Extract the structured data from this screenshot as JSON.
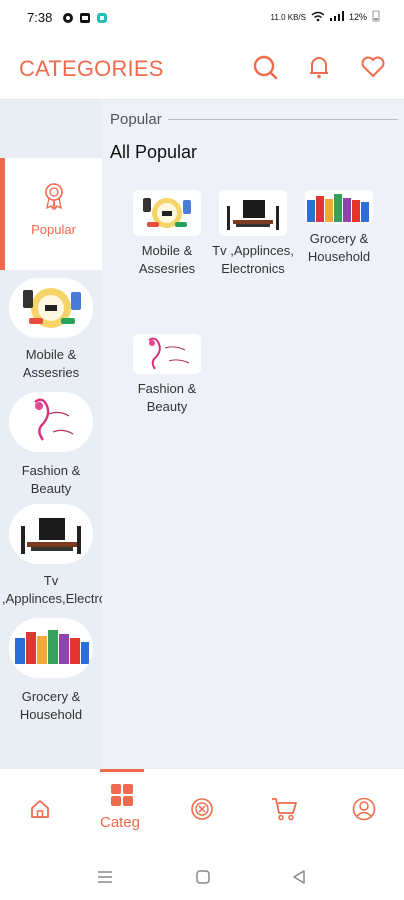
{
  "status": {
    "time": "7:38",
    "network": "11.0 KB/S",
    "battery": "12%",
    "icons": [
      "notification-icon",
      "gallery-icon",
      "app-badge-icon",
      "wifi-icon",
      "signal-icon",
      "battery-icon"
    ]
  },
  "app": {
    "title": "CATEGORIES",
    "actions": [
      "search-icon",
      "bell-icon",
      "heart-icon"
    ],
    "accent": "#ee6c4d"
  },
  "sidebar": {
    "items": [
      {
        "label": "Popular",
        "icon": "ribbon-icon",
        "active": true
      },
      {
        "label": "Mobile & Assesries",
        "image": "mobile-accessories-image"
      },
      {
        "label": "Fashion & Beauty",
        "image": "fashion-beauty-image"
      },
      {
        "label": "Tv ,Applinces,Electronics",
        "image": "tv-appliances-image"
      },
      {
        "label": "Grocery & Household",
        "image": "grocery-household-image"
      }
    ]
  },
  "main": {
    "section_label": "Popular",
    "all_title": "All Popular",
    "tiles": [
      {
        "label": "Mobile & Assesries",
        "image": "mobile-accessories-image"
      },
      {
        "label": "Tv ,Applinces, Electronics",
        "image": "tv-appliances-image"
      },
      {
        "label": "Grocery & Household",
        "image": "grocery-household-image"
      },
      {
        "label": "Fashion & Beauty",
        "image": "fashion-beauty-image"
      }
    ]
  },
  "bottom_nav": {
    "items": [
      {
        "icon": "home-icon"
      },
      {
        "icon": "grid-icon",
        "label": "Categ",
        "active": true
      },
      {
        "icon": "deals-icon"
      },
      {
        "icon": "cart-icon"
      },
      {
        "icon": "profile-icon"
      }
    ]
  },
  "system_nav": [
    "menu-icon",
    "home-square-icon",
    "back-triangle-icon"
  ]
}
